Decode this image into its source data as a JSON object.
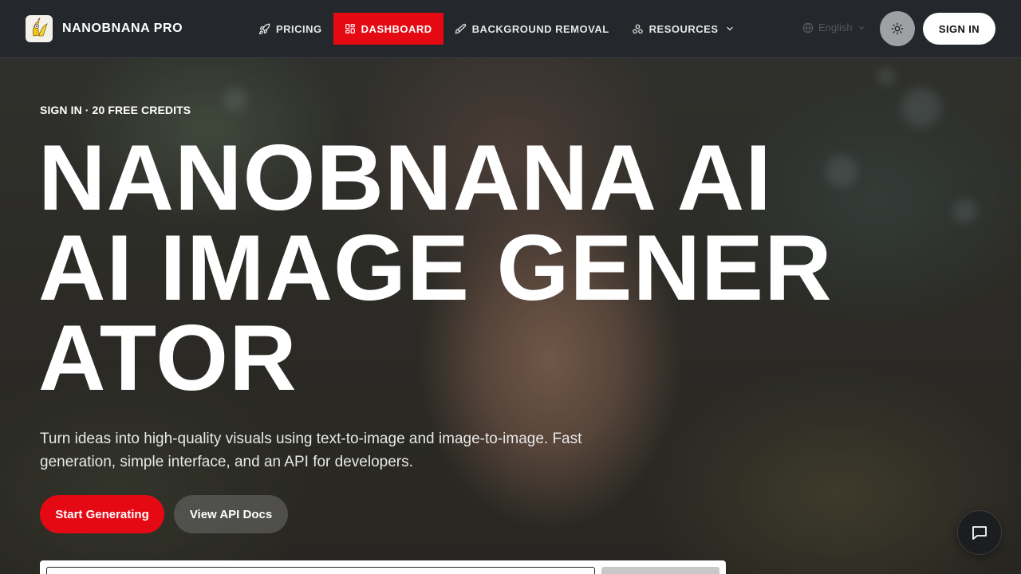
{
  "brand": {
    "name": "NANOBNANA PRO",
    "logo_icon": "banana-logo-icon"
  },
  "nav": {
    "items": [
      {
        "label": "PRICING",
        "icon": "rocket-icon",
        "active": false
      },
      {
        "label": "DASHBOARD",
        "icon": "grid-icon",
        "active": true
      },
      {
        "label": "BACKGROUND REMOVAL",
        "icon": "brush-icon",
        "active": false
      },
      {
        "label": "RESOURCES",
        "icon": "cluster-icon",
        "active": false,
        "has_dropdown": true
      }
    ]
  },
  "language": {
    "selected": "English",
    "icon": "globe-icon"
  },
  "theme_toggle": {
    "icon": "sun-icon"
  },
  "auth": {
    "signin_label": "SIGN IN"
  },
  "hero": {
    "eyebrow": "SIGN IN · 20 FREE CREDITS",
    "title_lines": [
      "NANOBNANA AI",
      "AI IMAGE GENER",
      "ATOR"
    ],
    "subtitle": "Turn ideas into high-quality visuals using text-to-image and image-to-image. Fast generation, simple interface, and an API for developers.",
    "primary_cta": "Start Generating",
    "secondary_cta": "View API Docs"
  },
  "chat": {
    "icon": "chat-bubble-icon"
  },
  "colors": {
    "accent": "#e50914",
    "header_bg": "#24272b",
    "text": "#ffffff"
  }
}
